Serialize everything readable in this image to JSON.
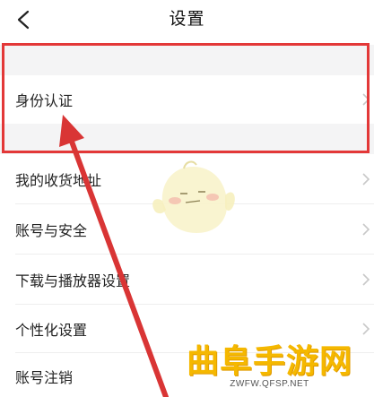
{
  "header": {
    "title": "设置"
  },
  "settings": {
    "items": [
      {
        "label": "身份认证"
      },
      {
        "label": "我的收货地址"
      },
      {
        "label": "账号与安全"
      },
      {
        "label": "下载与播放器设置"
      },
      {
        "label": "个性化设置"
      },
      {
        "label": "账号注销"
      }
    ]
  },
  "watermark": {
    "title": "曲阜手游网",
    "url": "ZWFW.QFSP.NET"
  },
  "colors": {
    "highlight": "#e33838",
    "section_band": "#f4f4f5",
    "watermark": "#f5b800"
  }
}
